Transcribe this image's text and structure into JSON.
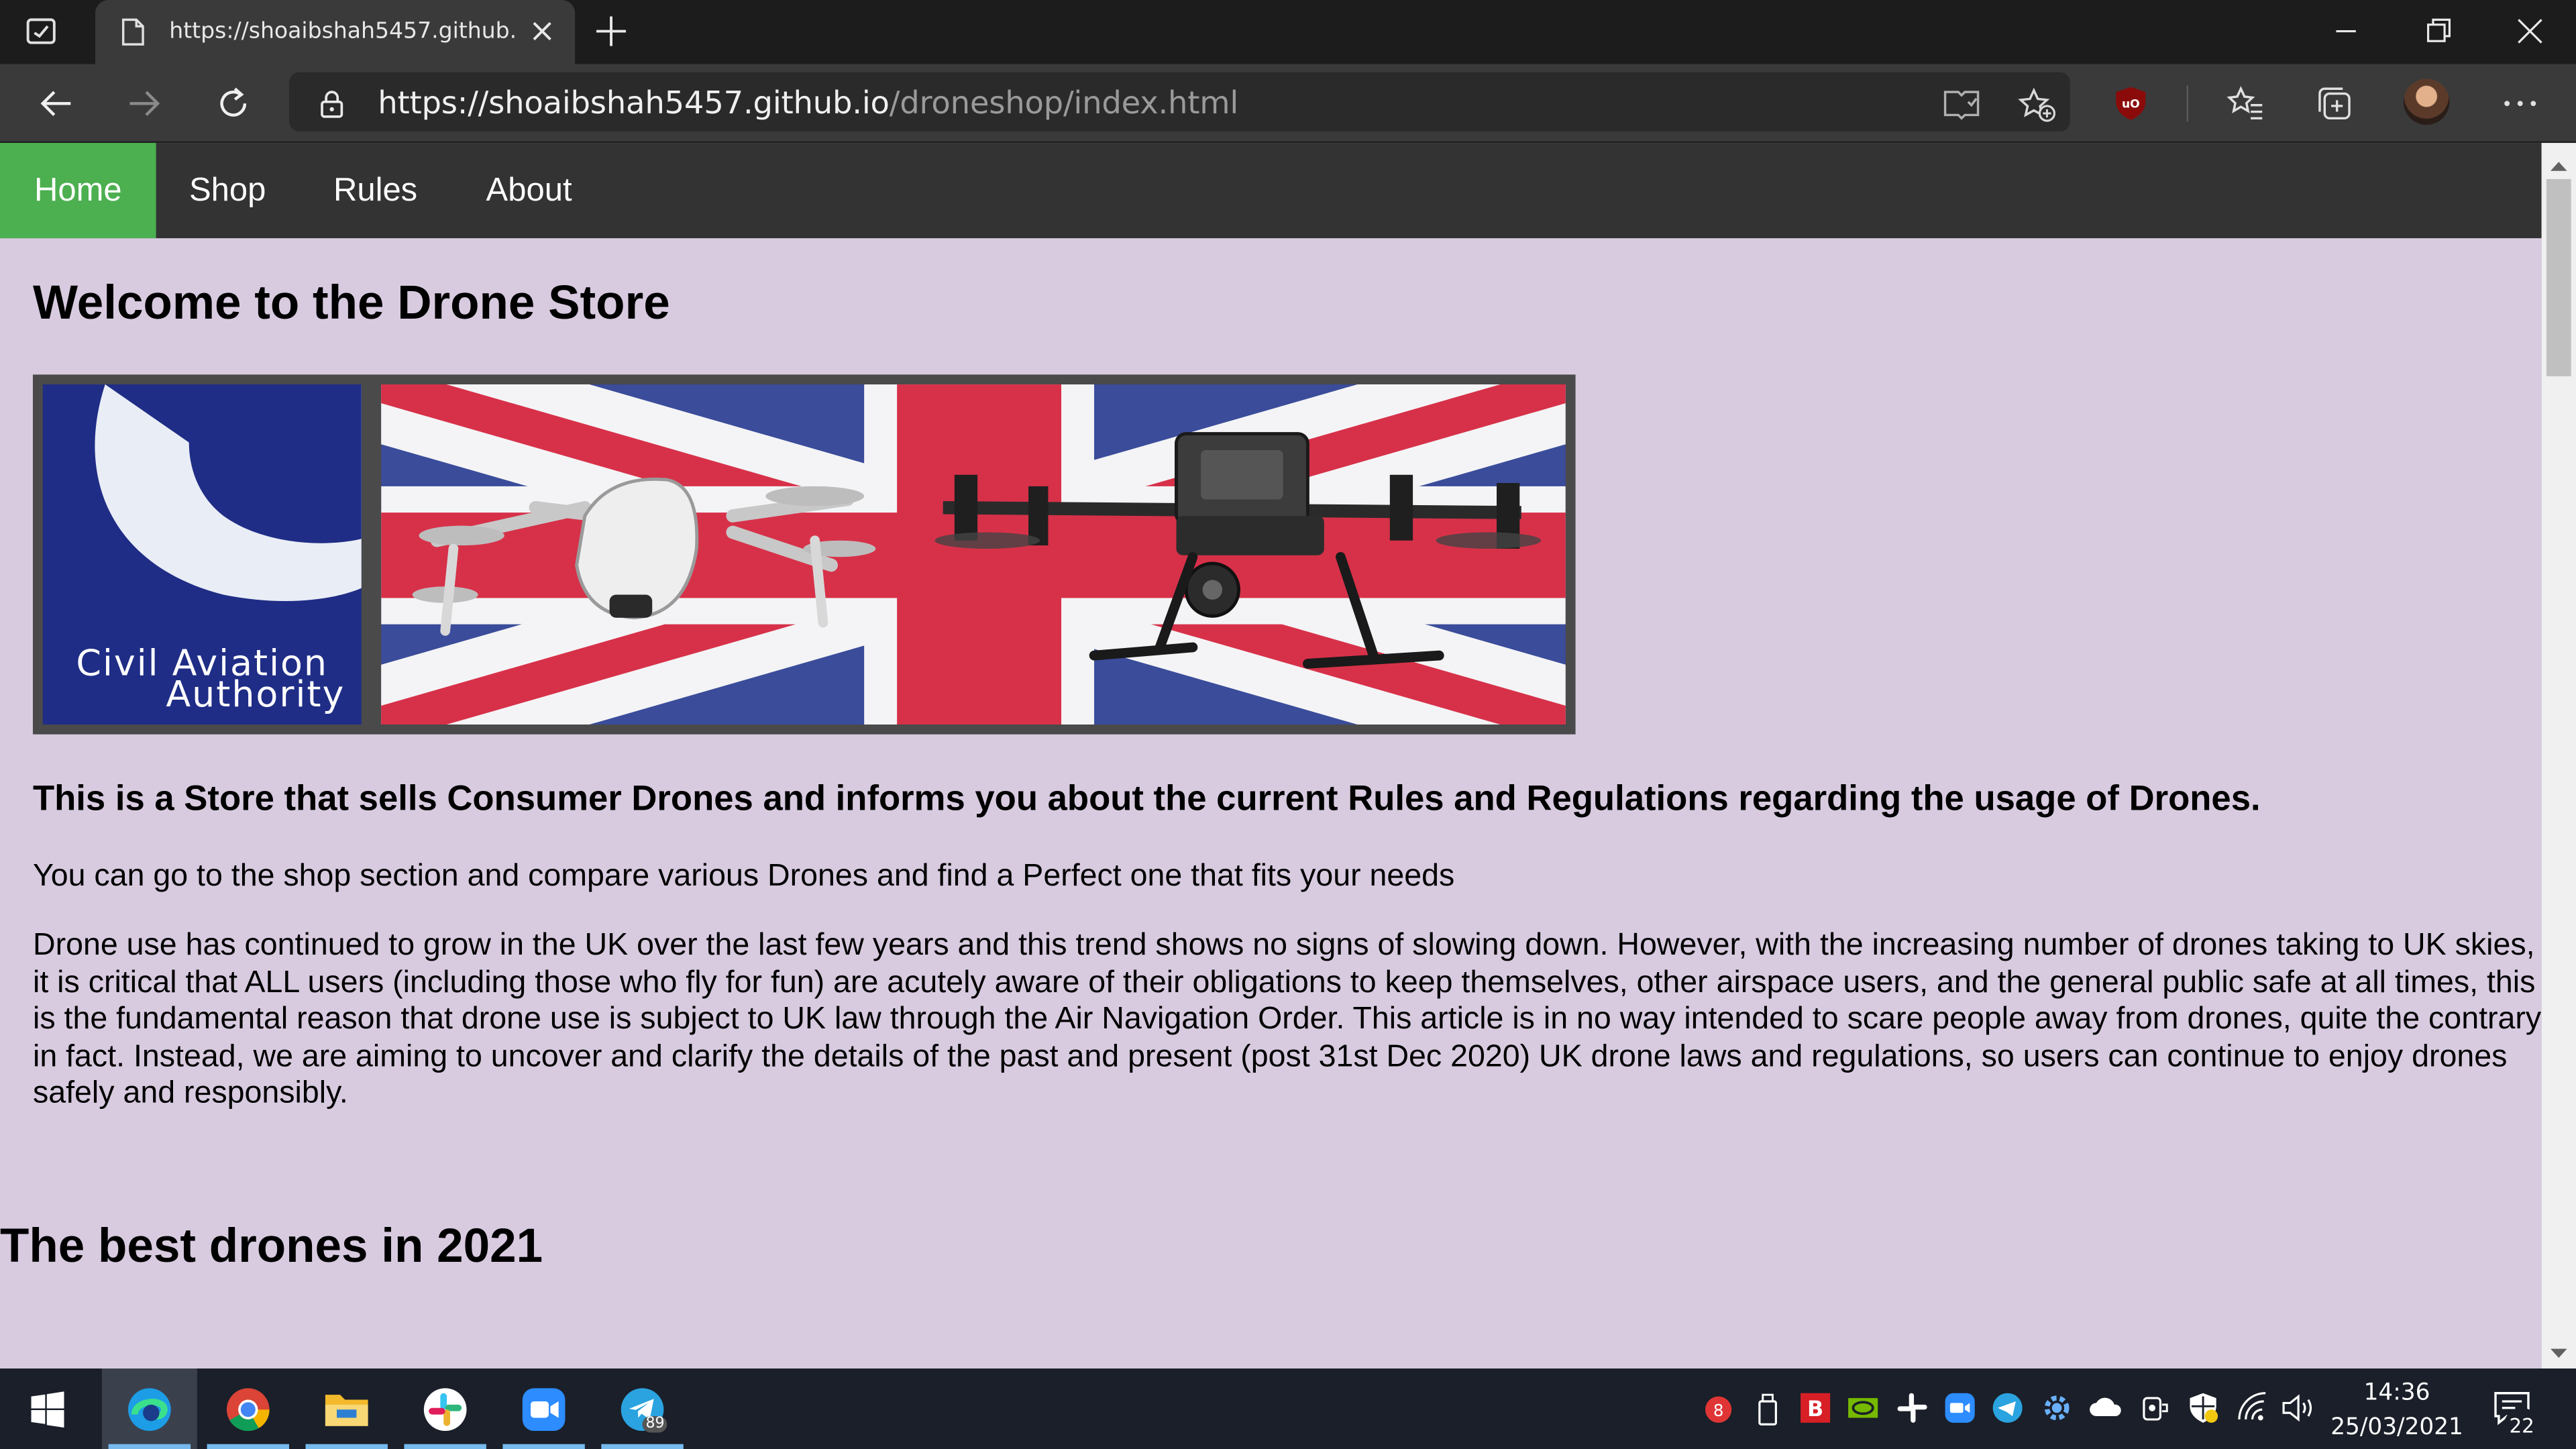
{
  "browser": {
    "tab_title": "https://shoaibshah5457.github.io/droneshop/index.html",
    "url_host": "https://shoaibshah5457.github.io",
    "url_path": "/droneshop/index.html"
  },
  "site": {
    "nav": [
      "Home",
      "Shop",
      "Rules",
      "About"
    ],
    "active_nav": "Home",
    "heading": "Welcome to the Drone Store",
    "banner_logo_line1": "Civil Aviation",
    "banner_logo_line2": "Authority",
    "intro": "This is a Store that sells Consumer Drones and informs you about the current Rules and Regulations regarding the usage of Drones.",
    "line1": "You can go to the shop section and compare various Drones and find a Perfect one that fits your needs",
    "paragraph": "Drone use has continued to grow in the UK over the last few years and this trend shows no signs of slowing down. However, with the increasing number of drones taking to UK skies, it is critical that ALL users (including those who fly for fun) are acutely aware of their obligations to keep themselves, other airspace users, and the general public safe at all times, this is the fundamental reason that drone use is subject to UK law through the Air Navigation Order. This article is in no way intended to scare people away from drones, quite the contrary in fact. Instead, we are aiming to uncover and clarify the details of the past and present (post 31st Dec 2020) UK drone laws and regulations, so users can continue to enjoy drones safely and responsibly.",
    "section_heading": "The best drones in 2021"
  },
  "taskbar": {
    "apps": [
      "windows-start-icon",
      "edge-icon",
      "chrome-icon",
      "file-explorer-icon",
      "slack-icon",
      "zoom-icon",
      "telegram-icon"
    ],
    "telegram_badge": "89",
    "time": "14:36",
    "date": "25/03/2021",
    "notification_count": "22"
  },
  "colors": {
    "page_bg": "#d8cbe0",
    "nav_bg": "#333333",
    "nav_active": "#4caf50"
  }
}
